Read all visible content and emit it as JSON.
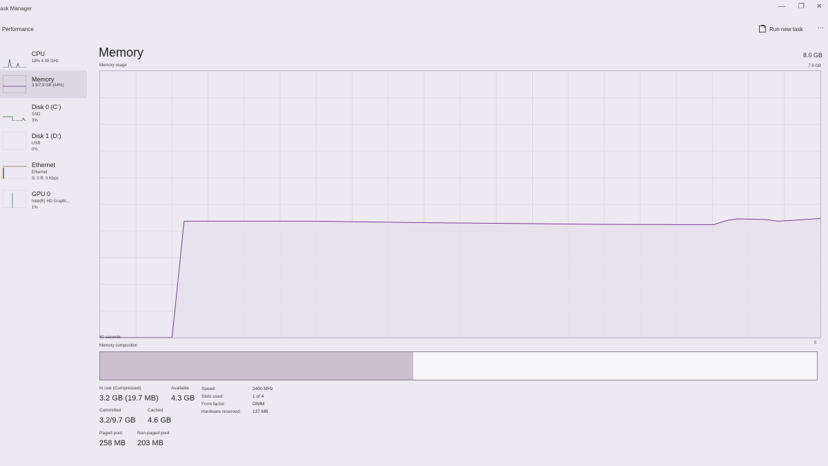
{
  "window": {
    "title": "ask Manager",
    "minimize_glyph": "—",
    "restore_glyph": "❐",
    "close_glyph": "✕"
  },
  "header": {
    "page_label": "Performance",
    "run_new_task": "Run new task",
    "more_glyph": "···"
  },
  "sidebar": {
    "items": [
      {
        "name": "CPU",
        "line1": "18% 4.08 GHz",
        "line2": ""
      },
      {
        "name": "Memory",
        "line1": "3.5/7.9 GB (44%)",
        "line2": ""
      },
      {
        "name": "Disk 0 (C:)",
        "line1": "SSD",
        "line2": "3%"
      },
      {
        "name": "Disk 1 (D:)",
        "line1": "USB",
        "line2": "0%"
      },
      {
        "name": "Ethernet",
        "line1": "Ethernet",
        "line2": "S: 0 R: 0 Kbps"
      },
      {
        "name": "GPU 0",
        "line1": "Intel(R) HD Graphi...",
        "line2": "1%"
      }
    ]
  },
  "main": {
    "title": "Memory",
    "total": "8.0 GB",
    "usage_label": "Memory usage",
    "usage_max": "7.9 GB",
    "time_label": "60 seconds",
    "zero_label": "0",
    "composition_label": "Memory composition"
  },
  "chart_data": {
    "type": "area",
    "title": "Memory usage",
    "xlabel": "60 seconds",
    "ylabel": "",
    "ylim": [
      0,
      7.9
    ],
    "grid": true,
    "x": [
      60,
      54,
      53,
      42,
      31,
      19,
      12,
      8.9,
      7.7,
      6.9,
      4.6,
      3.5,
      0
    ],
    "values": [
      0,
      0,
      3.45,
      3.45,
      3.4,
      3.36,
      3.35,
      3.35,
      3.48,
      3.52,
      3.5,
      3.45,
      3.53
    ]
  },
  "composition": {
    "in_use_fraction": 0.437,
    "modified_fraction": 0.0,
    "standby_fraction": 0.0,
    "colors": {
      "in_use": "#cbbfd0",
      "free": "#f7f7f9",
      "border": "#8a8392"
    }
  },
  "stats": {
    "in_use_label": "In use (Compressed)",
    "in_use_value": "3.2 GB (19.7 MB)",
    "available_label": "Available",
    "available_value": "4.3 GB",
    "committed_label": "Committed",
    "committed_value": "3.2/9.7 GB",
    "cached_label": "Cached",
    "cached_value": "4.6 GB",
    "paged_label": "Paged pool",
    "paged_value": "258 MB",
    "nonpaged_label": "Non-paged pool",
    "nonpaged_value": "203 MB"
  },
  "details": {
    "speed_label": "Speed:",
    "speed_value": "2400 MHz",
    "slots_label": "Slots used:",
    "slots_value": "1 of 4",
    "form_label": "Form factor:",
    "form_value": "DIMM",
    "reserved_label": "Hardware reserved:",
    "reserved_value": "137 MB"
  },
  "colors": {
    "accent": "#8b5aa8",
    "chart_fill": "#e6e0ec",
    "chart_line": "#7a3b98",
    "grid": "#d8d4de"
  }
}
